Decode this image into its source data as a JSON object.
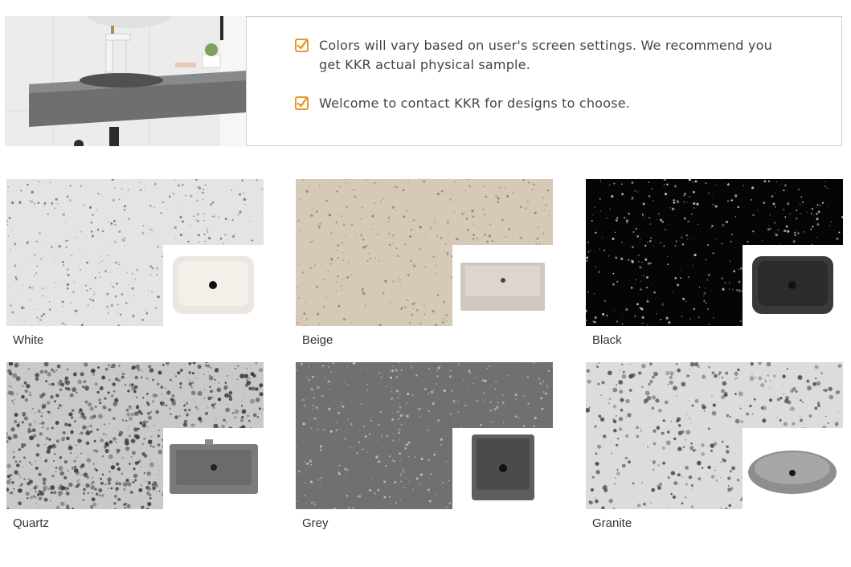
{
  "notes": [
    {
      "icon": "checkbox-check-icon",
      "text": "Colors will vary based on user's screen settings. We recommend you get KKR actual physical sample."
    },
    {
      "icon": "checkbox-check-icon",
      "text": "Welcome to contact KKR for designs to choose."
    }
  ],
  "accent_color": "#e8962b",
  "hero": {
    "image": "wall-mounted-grey-basin-photo"
  },
  "swatches": [
    {
      "name": "White",
      "stone_color": "#e4e4e4",
      "speckle_color": "#6b6b6b",
      "basin_color": "#ebe6e1",
      "basin_shape": "rounded-rect"
    },
    {
      "name": "Beige",
      "stone_color": "#d6c9b7",
      "speckle_color": "#8e7d66",
      "basin_color": "#cfc8c0",
      "basin_shape": "flat-rect"
    },
    {
      "name": "Black",
      "stone_color": "#050505",
      "speckle_color": "#dcdcdc",
      "basin_color": "#3a3a3a",
      "basin_shape": "rounded-rect"
    },
    {
      "name": "Quartz",
      "stone_color": "#c9c9c9",
      "speckle_color": "#3b3b3b",
      "basin_color": "#7a7b7d",
      "basin_shape": "rect-rim"
    },
    {
      "name": "Grey",
      "stone_color": "#6e716f",
      "speckle_color": "#c4c7c4",
      "basin_color": "#5e5e5e",
      "basin_shape": "square"
    },
    {
      "name": "Granite",
      "stone_color": "#dcdcda",
      "speckle_color": "#4a4a4a",
      "basin_color": "#8f8e8c",
      "basin_shape": "oval"
    }
  ]
}
